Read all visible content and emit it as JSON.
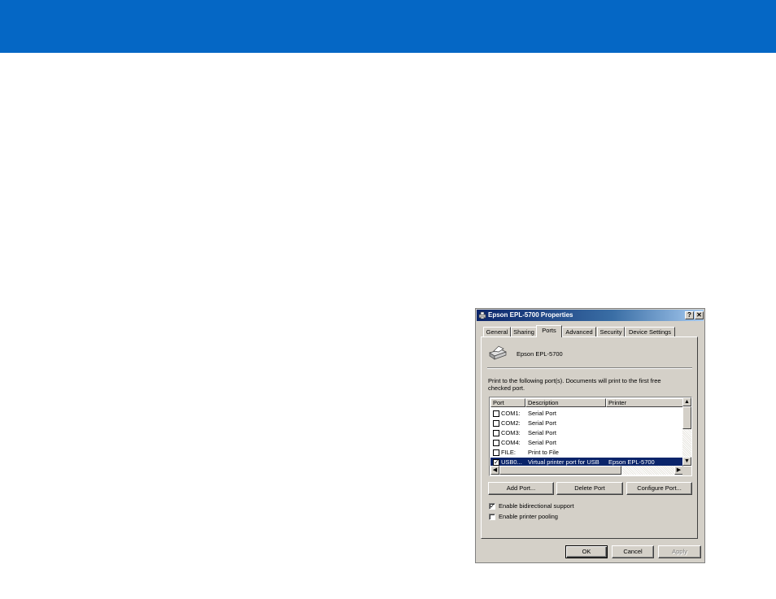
{
  "dialog": {
    "title": "Epson EPL-5700 Properties",
    "help_label": "?",
    "close_label": "✕",
    "tabs": [
      {
        "label": "General"
      },
      {
        "label": "Sharing"
      },
      {
        "label": "Ports"
      },
      {
        "label": "Advanced"
      },
      {
        "label": "Security"
      },
      {
        "label": "Device Settings"
      }
    ],
    "active_tab": "Ports",
    "printer_name": "Epson EPL-5700",
    "instructions": "Print to the following port(s). Documents will print to the first free checked port.",
    "list": {
      "columns": [
        "Port",
        "Description",
        "Printer"
      ],
      "rows": [
        {
          "checked": false,
          "check_glyph": "",
          "port": "COM1:",
          "description": "Serial Port",
          "printer": ""
        },
        {
          "checked": false,
          "check_glyph": "",
          "port": "COM2:",
          "description": "Serial Port",
          "printer": ""
        },
        {
          "checked": false,
          "check_glyph": "",
          "port": "COM3:",
          "description": "Serial Port",
          "printer": ""
        },
        {
          "checked": false,
          "check_glyph": "",
          "port": "COM4:",
          "description": "Serial Port",
          "printer": ""
        },
        {
          "checked": false,
          "check_glyph": "",
          "port": "FILE:",
          "description": "Print to File",
          "printer": ""
        },
        {
          "checked": true,
          "check_glyph": "✓",
          "port": "USB0...",
          "description": "Virtual printer port for USB",
          "printer": "Epson EPL-5700",
          "selected": true
        }
      ]
    },
    "scroll_glyphs": {
      "up": "▲",
      "down": "▼",
      "left": "◀",
      "right": "▶"
    },
    "buttons": {
      "add_port": "Add Port...",
      "delete_port": "Delete Port",
      "configure_port": "Configure Port..."
    },
    "options": {
      "bidirectional": {
        "label": "Enable bidirectional support",
        "checked": true,
        "glyph": "✓"
      },
      "pooling": {
        "label": "Enable printer pooling",
        "checked": false,
        "glyph": ""
      }
    },
    "footer": {
      "ok": "OK",
      "cancel": "Cancel",
      "apply": "Apply",
      "apply_enabled": false
    }
  },
  "colors": {
    "banner": "#0567c5",
    "dialog_face": "#d4d0c8",
    "title_active": "#0a246a",
    "selection": "#0a246a"
  }
}
